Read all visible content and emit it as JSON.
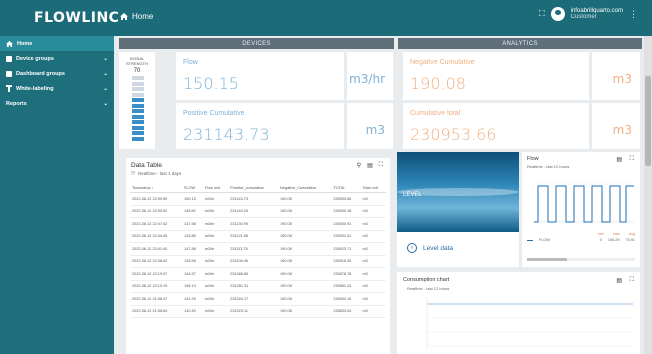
{
  "app": {
    "logo": "FLOWLINC",
    "home": "Home",
    "user_email": "infoabrillquarto.com",
    "user_role": "Customer"
  },
  "sidebar": {
    "items": [
      {
        "label": "Home",
        "icon": "home-icon"
      },
      {
        "label": "Device groups",
        "icon": "devices-icon"
      },
      {
        "label": "Dashboard groups",
        "icon": "dashboard-icon"
      },
      {
        "label": "White-labeling",
        "icon": "brush-icon"
      },
      {
        "label": "Reports",
        "icon": ""
      }
    ]
  },
  "devices": {
    "header": "DEVICES",
    "signal_title": "SIGNAL STRENGTH",
    "signal_value": "70",
    "signal_level": 0.7,
    "flow": {
      "label": "Flow",
      "value": "150.15",
      "unit": "m3/hr"
    },
    "positive": {
      "label": "Positive Cumulative",
      "value": "231143.73",
      "unit": "m3"
    }
  },
  "analytics": {
    "header": "ANALYTICS",
    "negative": {
      "label": "Negative Cumulative",
      "value": "190.08",
      "unit": "m3"
    },
    "total": {
      "label": "Cumulative total",
      "value": "230953.66",
      "unit": "m3"
    }
  },
  "table": {
    "title": "Data Table",
    "subtitle": "Realtime - last 1 days",
    "columns": [
      "Timestamp ↓",
      "FLOW",
      "Flow unit",
      "Positive_cumulative",
      "Negative_Cumulative",
      "TOTAL",
      "Total unit"
    ],
    "rows": [
      [
        "2022-06-12 22:50:59",
        "150.15",
        "m3/hr",
        "231143.73",
        "190.08",
        "230953.66",
        "m3"
      ],
      [
        "2022-06-12 22:50:02",
        "149.82",
        "m3/hr",
        "231140.25",
        "190.08",
        "230950.18",
        "m3"
      ],
      [
        "2022-06-12 22:47:42",
        "147.58",
        "m3/hr",
        "231130.99",
        "190.08",
        "230940.91",
        "m3"
      ],
      [
        "2022-06-12 22:44:45",
        "143.86",
        "m3/hr",
        "231121.58",
        "190.08",
        "230931.51",
        "m3"
      ],
      [
        "2022-06-12 22:41:40",
        "147.88",
        "m3/hr",
        "231113.78",
        "190.08",
        "230923.71",
        "m3"
      ],
      [
        "2022-06-12 22:38:42",
        "143.56",
        "m3/hr",
        "231106.46",
        "190.08",
        "230916.39",
        "m3"
      ],
      [
        "2022-06-12 22:19:37",
        "144.67",
        "m3/hr",
        "231068.86",
        "190.08",
        "230878.78",
        "m3"
      ],
      [
        "2022-06-12 22:10:19",
        "146.13",
        "m3/hr",
        "231051.31",
        "190.08",
        "230861.24",
        "m3"
      ],
      [
        "2022-06-12 21:56:47",
        "143.33",
        "m3/hr",
        "231024.17",
        "190.08",
        "230834.10",
        "m3"
      ],
      [
        "2022-06-12 21:55:54",
        "140.40",
        "m3/hr",
        "231023.11",
        "190.08",
        "230833.04",
        "m3"
      ]
    ]
  },
  "level": {
    "title": "LEVEL",
    "link": "Level data"
  },
  "flow_chart": {
    "title": "Flow",
    "subtitle": "Realtime - last 12 hours",
    "legend": {
      "name": "FLOW",
      "min_label": "min",
      "max_label": "max",
      "avg_label": "avg",
      "min": "0",
      "max": "155.29",
      "avg": "75.91"
    }
  },
  "consumption": {
    "title": "Consumption chart",
    "subtitle": "Realtime - last 12 hours"
  },
  "colors": {
    "topbar": "#1b6b78",
    "sidebar": "#1d6f7c",
    "accent": "#7fb0d4",
    "panel_header": "#5f6f7a",
    "orange": "#f0b183"
  }
}
